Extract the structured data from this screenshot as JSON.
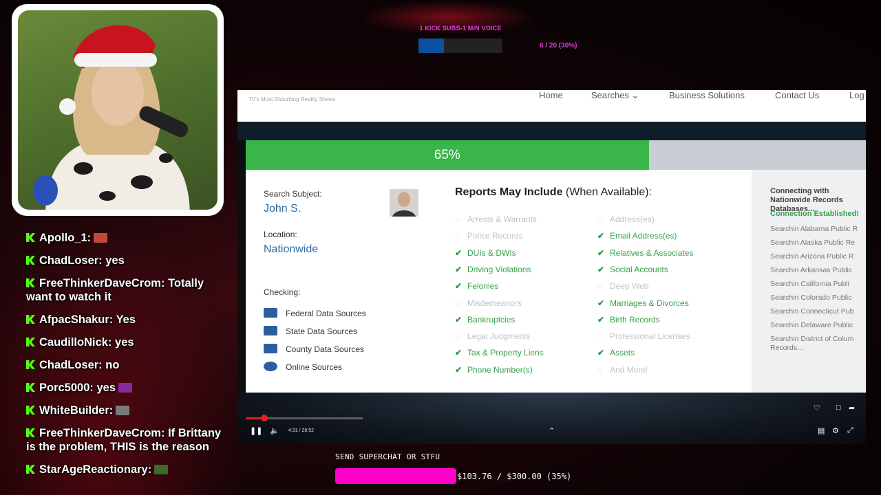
{
  "sub_goal": {
    "title": "1 KICK SUBS-1 MIN VOICE",
    "progress_text": "6 / 20 (30%)",
    "progress": 0.3,
    "color": "#0b4fa0"
  },
  "chat": [
    {
      "user": "Apollo_1",
      "text": "",
      "emote": true
    },
    {
      "user": "ChadLoser",
      "text": "yes"
    },
    {
      "user": "FreeThinkerDaveCrom",
      "text": "Totally want to watch it"
    },
    {
      "user": "AfpacShakur",
      "text": "Yes"
    },
    {
      "user": "CaudilloNick",
      "text": "yes"
    },
    {
      "user": "ChadLoser",
      "text": "no"
    },
    {
      "user": "Porc5000",
      "text": "yes",
      "emote": true
    },
    {
      "user": "WhiteBuilder",
      "text": "",
      "emote": true
    },
    {
      "user": "FreeThinkerDaveCrom",
      "text": "If Brittany is the problem, THIS is the reason"
    },
    {
      "user": "StarAgeReactionary",
      "text": "",
      "emote": true
    }
  ],
  "video": {
    "channel_tag": "TV's Most Disturbing Reality Shows",
    "nav": [
      "Home",
      "Searches",
      "Business Solutions",
      "Contact Us",
      "Log"
    ],
    "progress_label": "65%",
    "progress": 0.65,
    "search_subject_label": "Search Subject:",
    "search_subject": "John S.",
    "location_label": "Location:",
    "location": "Nationwide",
    "checking_label": "Checking:",
    "sources": [
      "Federal Data Sources",
      "State Data Sources",
      "County Data Sources",
      "Online Sources"
    ],
    "reports_title_bold": "Reports May Include",
    "reports_title_rest": " (When Available):",
    "reports_left": [
      {
        "label": "Arrests & Warrants",
        "done": false
      },
      {
        "label": "Police Records",
        "done": false
      },
      {
        "label": "DUIs & DWIs",
        "done": true
      },
      {
        "label": "Driving Violations",
        "done": true
      },
      {
        "label": "Felonies",
        "done": true
      },
      {
        "label": "Misdemeanors",
        "done": false
      },
      {
        "label": "Bankruptcies",
        "done": true
      },
      {
        "label": "Legal Judgments",
        "done": false
      },
      {
        "label": "Tax & Property Liens",
        "done": true
      },
      {
        "label": "Phone Number(s)",
        "done": true
      }
    ],
    "reports_right": [
      {
        "label": "Address(es)",
        "done": false
      },
      {
        "label": "Email Address(es)",
        "done": true
      },
      {
        "label": "Relatives & Associates",
        "done": true
      },
      {
        "label": "Social Accounts",
        "done": true
      },
      {
        "label": "Deep Web",
        "done": false
      },
      {
        "label": "Marriages & Divorces",
        "done": true
      },
      {
        "label": "Birth Records",
        "done": true
      },
      {
        "label": "Professional Licenses",
        "done": false
      },
      {
        "label": "Assets",
        "done": true
      },
      {
        "label": "And More!",
        "done": false
      }
    ],
    "connecting_title": "Connecting with Nationwide Records Databases...",
    "connection_status": "Connection Established!",
    "connecting_items": [
      "Searchin Alabama Public R",
      "Searchin Alaska Public Re",
      "Searchin Arizona Public R",
      "Searchin Arkansas Public",
      "Searchin California Publi",
      "Searchin Colorado Public",
      "Searchin Connecticut Pub",
      "Searchin Delaware Public",
      "Searchin District of Colum",
      "Records..."
    ],
    "time": "4:31 / 28:52",
    "playback": 0.16
  },
  "superchat": {
    "title": "SEND SUPERCHAT OR STFU",
    "progress_text": "$103.76 / $300.00 (35%)",
    "color": "#ff00c8"
  }
}
